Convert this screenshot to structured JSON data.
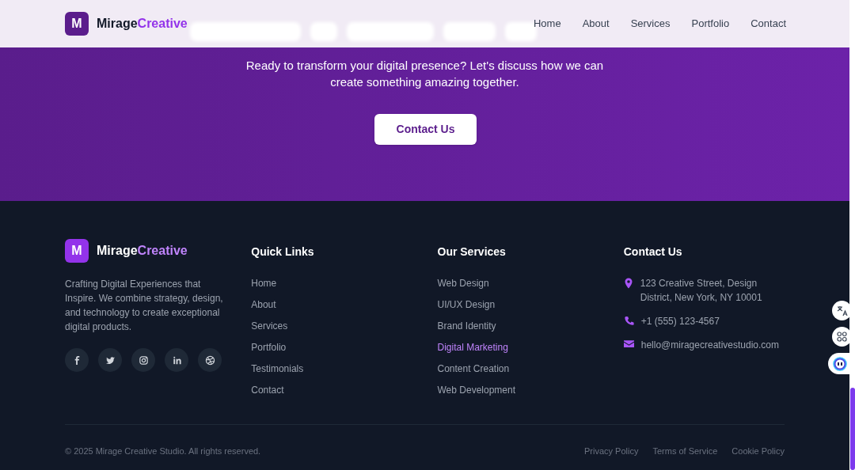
{
  "header": {
    "logo_letter": "M",
    "brand": "Mirage",
    "brand_accent": "Creative",
    "nav": [
      {
        "label": "Home"
      },
      {
        "label": "About"
      },
      {
        "label": "Services"
      },
      {
        "label": "Portfolio"
      },
      {
        "label": "Contact"
      }
    ]
  },
  "cta": {
    "text": "Ready to transform your digital presence? Let's discuss how we can create something amazing together.",
    "button": "Contact Us"
  },
  "footer": {
    "logo_letter": "M",
    "brand": "Mirage",
    "brand_accent": "Creative",
    "description": "Crafting Digital Experiences that Inspire. We combine strategy, design, and technology to create exceptional digital products.",
    "social": [
      {
        "kind": "facebook"
      },
      {
        "kind": "twitter"
      },
      {
        "kind": "instagram"
      },
      {
        "kind": "linkedin"
      },
      {
        "kind": "dribbble"
      }
    ],
    "quick_links": {
      "title": "Quick Links",
      "items": [
        {
          "label": "Home",
          "selected": false
        },
        {
          "label": "About",
          "selected": false
        },
        {
          "label": "Services",
          "selected": false
        },
        {
          "label": "Portfolio",
          "selected": false
        },
        {
          "label": "Testimonials",
          "selected": false
        },
        {
          "label": "Contact",
          "selected": false
        }
      ]
    },
    "services": {
      "title": "Our Services",
      "items": [
        {
          "label": "Web Design",
          "selected": false
        },
        {
          "label": "UI/UX Design",
          "selected": false
        },
        {
          "label": "Brand Identity",
          "selected": false
        },
        {
          "label": "Digital Marketing",
          "selected": true
        },
        {
          "label": "Content Creation",
          "selected": false
        },
        {
          "label": "Web Development",
          "selected": false
        }
      ]
    },
    "contact": {
      "title": "Contact Us",
      "items": [
        {
          "kind": "address",
          "text": "123 Creative Street, Design District, New York, NY 10001"
        },
        {
          "kind": "phone",
          "text": "+1 (555) 123-4567"
        },
        {
          "kind": "email",
          "text": "hello@miragecreativestudio.com"
        }
      ]
    },
    "copyright": "© 2025 Mirage Creative Studio. All rights reserved.",
    "legal_links": [
      {
        "label": "Privacy Policy"
      },
      {
        "label": "Terms of Service"
      },
      {
        "label": "Cookie Policy"
      }
    ]
  }
}
